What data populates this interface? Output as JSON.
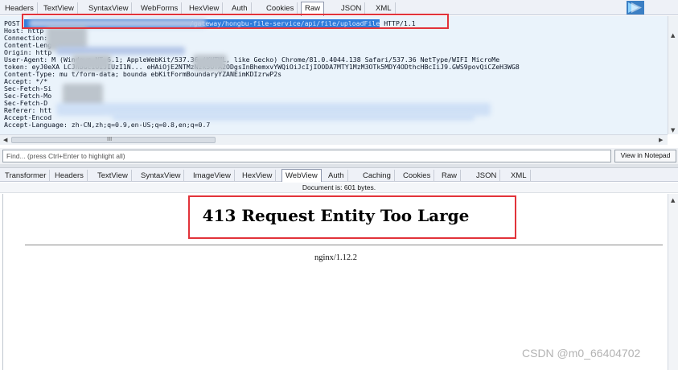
{
  "request_tabs": [
    "Headers",
    "TextView",
    "SyntaxView",
    "WebForms",
    "HexView",
    "Auth",
    "Cookies",
    "Raw",
    "JSON",
    "XML"
  ],
  "request_active_tab": "Raw",
  "raw_request": {
    "method": "POST",
    "url_visible": "/gateway/hongbu-file-service/api/file/uploadFile",
    "protocol": "HTTP/1.1",
    "lines": [
      "Host: http",
      "Connection:",
      "Content-Leng",
      "Origin: http",
      "User-Agent: M          (Windows NT 6.1;        AppleWebKit/537.36 (KHTML, like Gecko) Chrome/81.0.4044.138 Safari/537.36 NetType/WIFI MicroMe",
      "token: eyJ0eXA          LCJhbGciOiJIUzI1N...        eHAiOjE2NTMzNzk5OTA2ODgsInBhemxvYWQiOiJcIjIOODA7MTY1MzM3OTk5MDY4ODthcHBcIiJ9.GWS9povQiCZeH3WG8",
      "Content-Type: mu          t/form-data; bounda          ebKitFormBoundaryYZANEimKDIzrwP2s",
      "Accept: */*",
      "Sec-Fetch-Si",
      "Sec-Fetch-Mo",
      "Sec-Fetch-D",
      "Referer: htt",
      "Accept-Encod",
      "Accept-Language: zh-CN,zh;q=0.9,en-US;q=0.8,en;q=0.7"
    ]
  },
  "hscroll_label": "III",
  "find_placeholder": "Find... (press Ctrl+Enter to highlight all)",
  "view_in_notepad": "View in Notepad",
  "response_tabs": [
    "Transformer",
    "Headers",
    "TextView",
    "SyntaxView",
    "ImageView",
    "HexView",
    "WebView",
    "Auth",
    "Caching",
    "Cookies",
    "Raw",
    "JSON",
    "XML"
  ],
  "response_active_tab": "WebView",
  "document_info": "Document is: 601 bytes.",
  "webview": {
    "title": "413 Request Entity Too Large",
    "server": "nginx/1.12.2"
  },
  "watermark": "CSDN @m0_66404702",
  "colors": {
    "url_highlight": "#2f7cdb",
    "annotation_red": "#e2333a",
    "raw_background": "#eaf3fb"
  }
}
